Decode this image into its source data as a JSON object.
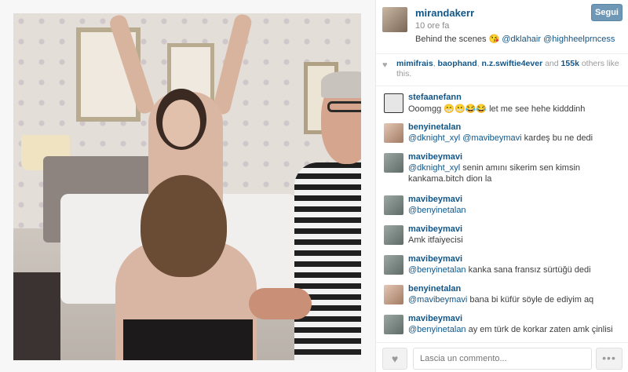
{
  "post": {
    "username": "mirandakerr",
    "time": "10 ore fa",
    "caption_text": "Behind the scenes",
    "caption_emoji": "😘",
    "caption_mention1": "@dklahair",
    "caption_mention2": "@highheelprncess",
    "follow_label": "Segui"
  },
  "likes": {
    "users": [
      "mimifrais",
      "baophand",
      "n.z.swiftie4ever"
    ],
    "sep": ",",
    "and": "and",
    "count": "155k",
    "rest": "others like this."
  },
  "comments": [
    {
      "user": "stefaanefann",
      "text": "Ooomgg 😁😬😂😂 let me see hehe kidddinh",
      "avatar_color": "#555555"
    },
    {
      "user": "benyinetalan",
      "mention": "@dknight_xyl @mavibeymavi",
      "text": " kardeş bu ne dedi",
      "avatar_color": "#c4a08a"
    },
    {
      "user": "mavibeymavi",
      "mention": "@dknight_xyl",
      "text": " senin amını sikerim sen kimsin",
      "text2": "kankama.bitch dion la",
      "avatar_color": "#7d8a86"
    },
    {
      "user": "mavibeymavi",
      "mention": "@benyinetalan",
      "text": "",
      "avatar_color": "#7d8a86"
    },
    {
      "user": "mavibeymavi",
      "text": "Amk itfaiyecisi",
      "avatar_color": "#7d8a86"
    },
    {
      "user": "mavibeymavi",
      "mention": "@benyinetalan",
      "text": " kanka sana fransız sürtüğü dedi",
      "avatar_color": "#7d8a86"
    },
    {
      "user": "benyinetalan",
      "mention": "@mavibeymavi",
      "text": " bana bi küfür söyle de ediyim aq",
      "avatar_color": "#c4a08a"
    },
    {
      "user": "mavibeymavi",
      "mention": "@benyinetalan",
      "text": " ay em türk de korkar zaten amk çinlisi",
      "avatar_color": "#7d8a86"
    }
  ],
  "footer": {
    "like_icon": "♥",
    "comment_placeholder": "Lascia un commento...",
    "more_icon": "•••"
  },
  "colors": {
    "link": "#125688",
    "follow_bg": "#6f97b6"
  }
}
